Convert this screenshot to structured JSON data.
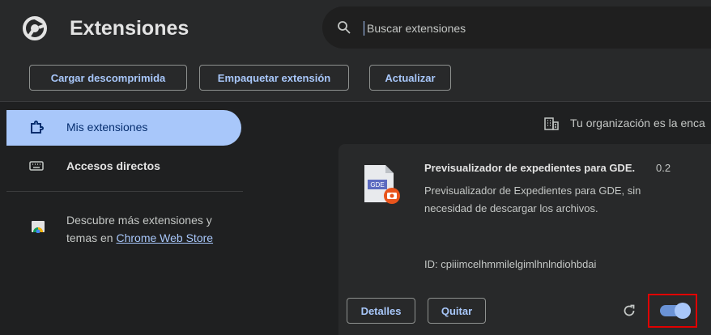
{
  "header": {
    "title": "Extensiones",
    "search_placeholder": "Buscar extensiones"
  },
  "toolbar": {
    "load_unpacked": "Cargar descomprimida",
    "pack_extension": "Empaquetar extensión",
    "update": "Actualizar"
  },
  "sidebar": {
    "items": [
      {
        "label": "Mis extensiones",
        "icon": "puzzle-icon",
        "active": true
      },
      {
        "label": "Accesos directos",
        "icon": "keyboard-icon",
        "active": false
      }
    ],
    "store_text": "Descubre más extensiones y temas en ",
    "store_link": "Chrome Web Store"
  },
  "main": {
    "org_notice": "Tu organización es la enca"
  },
  "extension": {
    "name": "Previsualizador de expedientes para GDE.",
    "version": "0.2",
    "description": "Previsualizador de Expedientes para GDE, sin necesidad de descargar los archivos.",
    "icon_label": "GDE",
    "id_text": "ID: cpiiimcelhmmilelgimlhnlndiohbdai",
    "details_label": "Detalles",
    "remove_label": "Quitar",
    "enabled": true
  },
  "colors": {
    "accent": "#a8c7fa",
    "highlight_box": "#e00000"
  }
}
